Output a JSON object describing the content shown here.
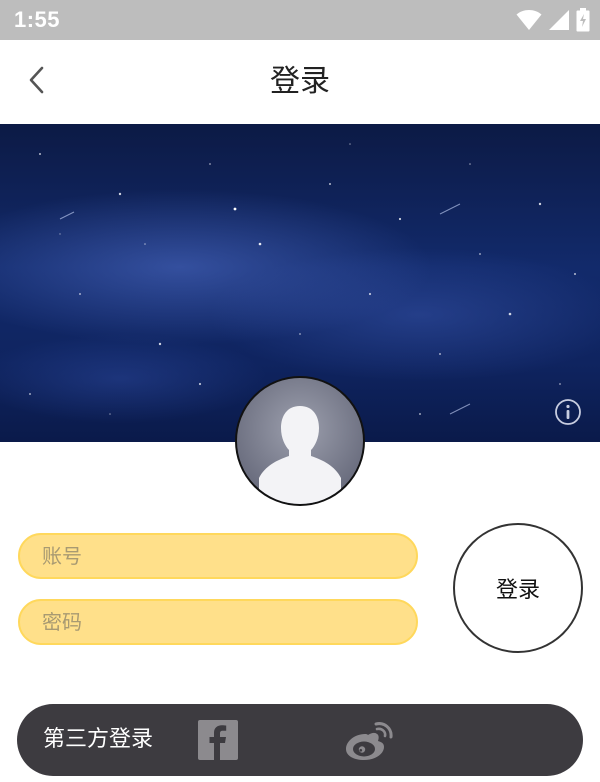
{
  "status_bar": {
    "time": "1:55",
    "icons": [
      "wifi-icon",
      "signal-icon",
      "battery-icon"
    ]
  },
  "app_bar": {
    "title": "登录",
    "back_icon": "chevron-left-icon"
  },
  "banner": {
    "info_icon": "info-icon"
  },
  "avatar": {
    "icon": "user-silhouette-icon"
  },
  "form": {
    "account_placeholder": "账号",
    "account_value": "",
    "password_placeholder": "密码",
    "password_value": "",
    "login_label": "登录"
  },
  "third_party": {
    "label": "第三方登录",
    "providers": [
      "facebook-icon",
      "weibo-icon"
    ]
  },
  "colors": {
    "status_bar": "#bdbdbd",
    "input_fill": "#ffe08a",
    "third_party_bar": "#3d3b40"
  }
}
